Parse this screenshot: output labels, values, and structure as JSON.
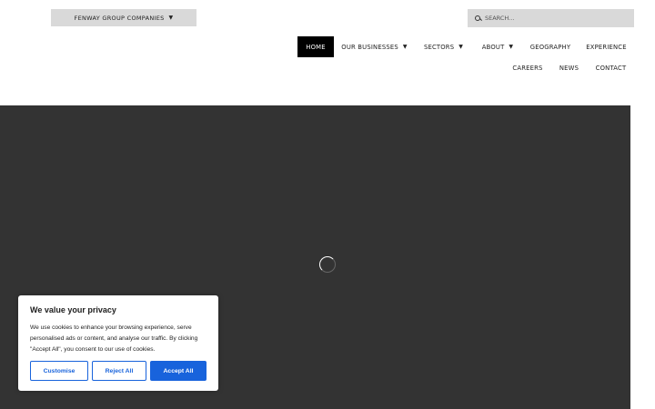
{
  "header": {
    "group_dropdown_label": "FENWAY GROUP COMPANIES",
    "search_placeholder": "SEARCH..."
  },
  "nav": {
    "items": [
      {
        "label": "HOME",
        "active": true
      },
      {
        "label": "OUR BUSINESSES",
        "has_dropdown": true
      },
      {
        "label": "SECTORS",
        "has_dropdown": true
      },
      {
        "label": "ABOUT",
        "has_dropdown": true
      },
      {
        "label": "GEOGRAPHY"
      },
      {
        "label": "EXPERIENCE"
      },
      {
        "label": "CAREERS"
      },
      {
        "label": "NEWS"
      },
      {
        "label": "CONTACT"
      }
    ]
  },
  "hero": {
    "background_color": "#333333",
    "loading_indicator": "spinner"
  },
  "cookie_banner": {
    "title": "We value your privacy",
    "text": "We use cookies to enhance your browsing experience, serve personalised ads or content, and analyse our traffic. By clicking \"Accept All\", you consent to our use of cookies.",
    "customise_label": "Customise",
    "reject_label": "Reject All",
    "accept_label": "Accept All",
    "accent_color": "#1863dc"
  },
  "icons": {
    "dropdown_caret": "caret-down-icon",
    "search": "search-icon",
    "loading": "spinner-icon"
  }
}
